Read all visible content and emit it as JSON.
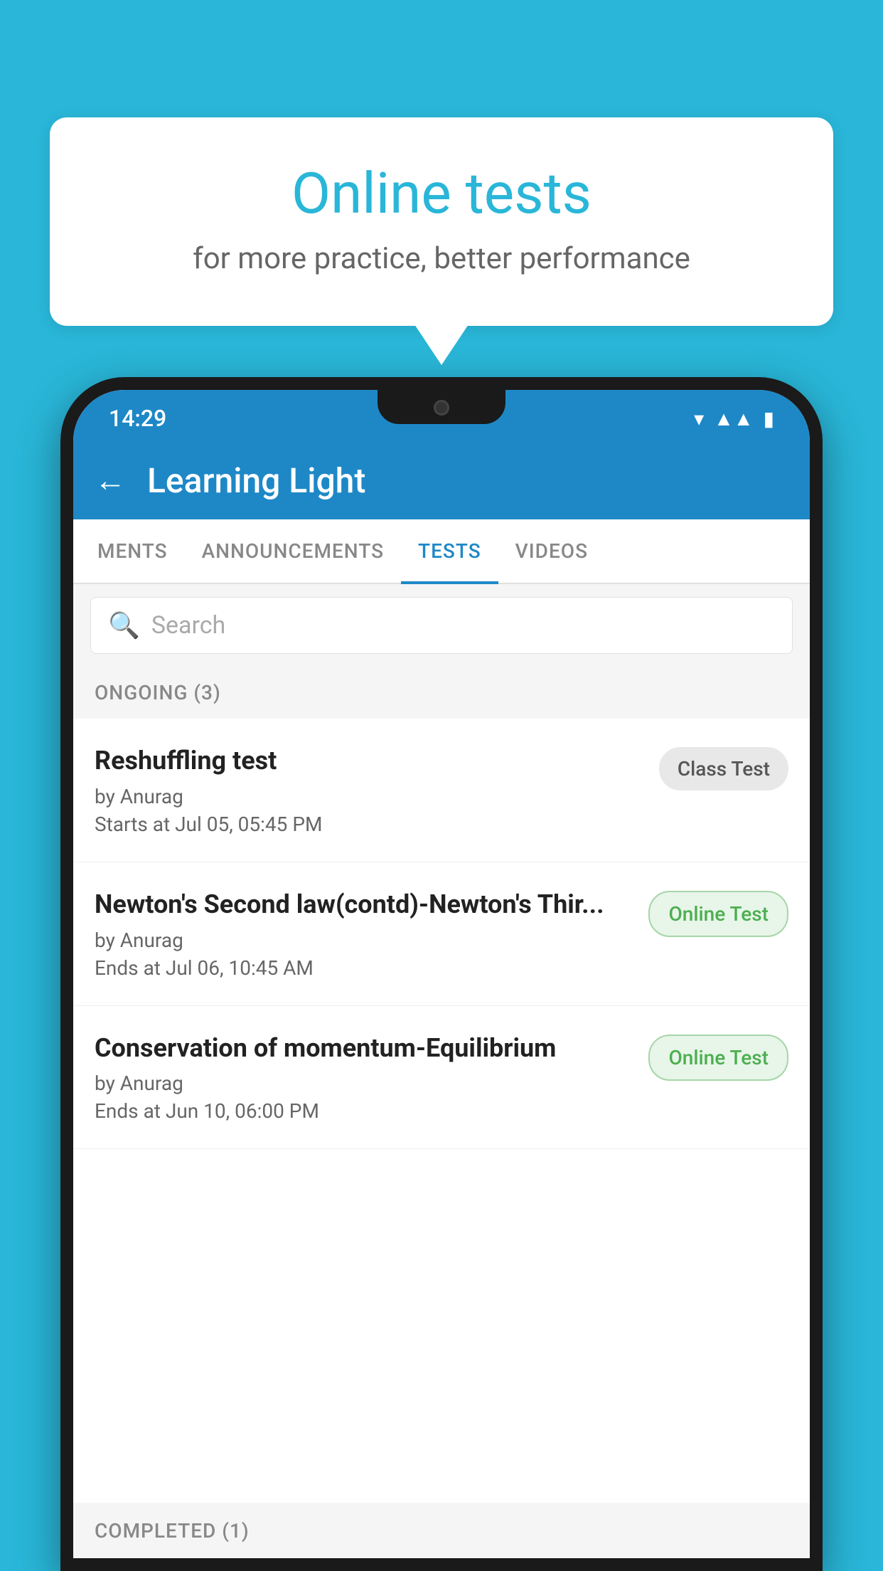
{
  "background": {
    "color": "#29b6d8"
  },
  "speech_bubble": {
    "title": "Online tests",
    "subtitle": "for more practice, better performance"
  },
  "status_bar": {
    "time": "14:29",
    "wifi_icon": "▾",
    "signal_icon": "▲",
    "battery_icon": "▮"
  },
  "app_bar": {
    "back_icon": "←",
    "title": "Learning Light"
  },
  "tabs": [
    {
      "label": "MENTS",
      "active": false
    },
    {
      "label": "ANNOUNCEMENTS",
      "active": false
    },
    {
      "label": "TESTS",
      "active": true
    },
    {
      "label": "VIDEOS",
      "active": false
    }
  ],
  "search": {
    "placeholder": "Search",
    "icon": "🔍"
  },
  "sections": {
    "ongoing": {
      "label": "ONGOING (3)",
      "tests": [
        {
          "name": "Reshuffling test",
          "author": "by Anurag",
          "date": "Starts at  Jul 05, 05:45 PM",
          "badge": "Class Test",
          "badge_type": "class"
        },
        {
          "name": "Newton's Second law(contd)-Newton's Thir...",
          "author": "by Anurag",
          "date": "Ends at  Jul 06, 10:45 AM",
          "badge": "Online Test",
          "badge_type": "online"
        },
        {
          "name": "Conservation of momentum-Equilibrium",
          "author": "by Anurag",
          "date": "Ends at  Jun 10, 06:00 PM",
          "badge": "Online Test",
          "badge_type": "online"
        }
      ]
    },
    "completed": {
      "label": "COMPLETED (1)"
    }
  }
}
